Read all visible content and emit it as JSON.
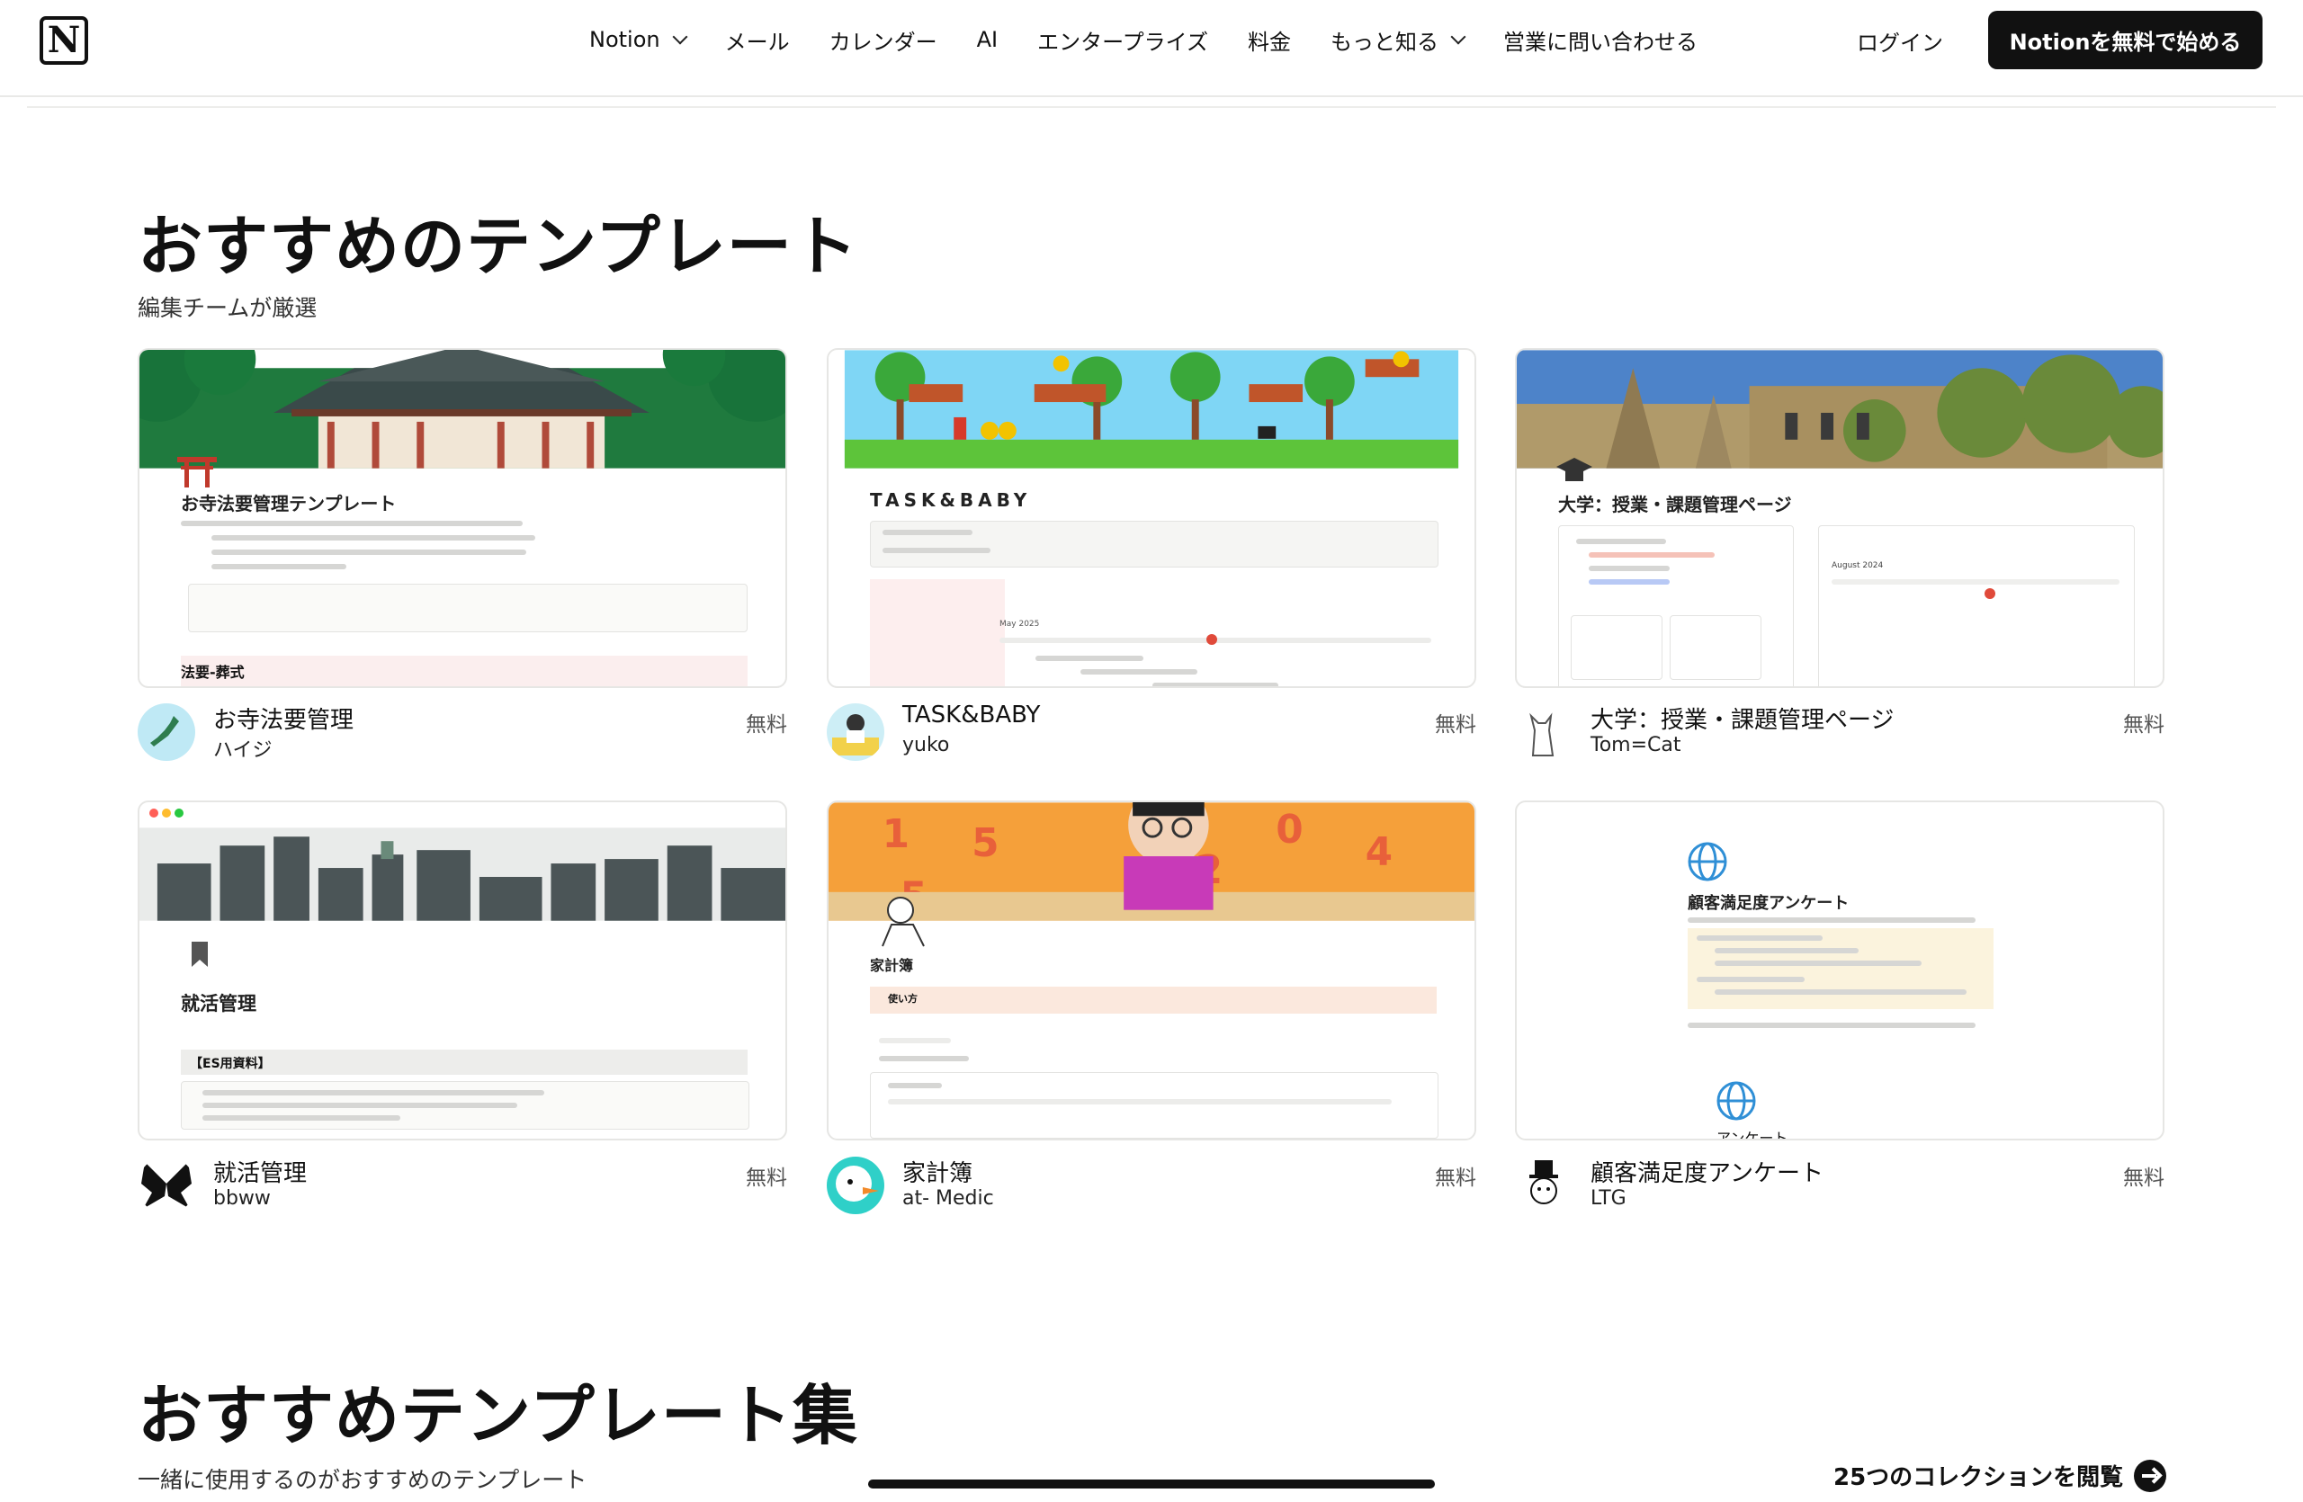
{
  "nav": {
    "logo": "N",
    "items": [
      {
        "label": "Notion",
        "dropdown": true
      },
      {
        "label": "メール",
        "dropdown": false
      },
      {
        "label": "カレンダー",
        "dropdown": false
      },
      {
        "label": "AI",
        "dropdown": false
      },
      {
        "label": "エンタープライズ",
        "dropdown": false
      },
      {
        "label": "料金",
        "dropdown": false
      },
      {
        "label": "もっと知る",
        "dropdown": true
      },
      {
        "label": "営業に問い合わせる",
        "dropdown": false
      }
    ],
    "login": "ログイン",
    "cta": "Notionを無料で始める"
  },
  "featured": {
    "title": "おすすめのテンプレート",
    "subtitle": "編集チームが厳選",
    "templates": [
      {
        "name": "お寺法要管理",
        "author": "ハイジ",
        "price": "無料",
        "preview_title": "お寺法要管理テンプレート",
        "preview_section": "法要-葬式"
      },
      {
        "name": "TASK&BABY",
        "author": "yuko",
        "price": "無料",
        "preview_title": "TASK&BABY",
        "preview_section": "May 2025"
      },
      {
        "name": "大学：授業・課題管理ページ",
        "author": "Tom=Cat",
        "price": "無料",
        "preview_title": "大学：授業・課題管理ページ",
        "preview_section": "August 2024"
      },
      {
        "name": "就活管理",
        "author": "bbww",
        "price": "無料",
        "preview_title": "就活管理",
        "preview_section": "【ES用資料】"
      },
      {
        "name": "家計簿",
        "author": "at- Medic",
        "price": "無料",
        "preview_title": "家計簿",
        "preview_section": "使い方"
      },
      {
        "name": "顧客満足度アンケート",
        "author": "LTG",
        "price": "無料",
        "preview_title": "顧客満足度アンケート",
        "preview_section": "アンケート"
      }
    ]
  },
  "collections": {
    "title": "おすすめテンプレート集",
    "subtitle": "一緒に使用するのがおすすめのテンプレート",
    "browse": "25つのコレクションを閲覧"
  },
  "colors": {
    "accent": "#111111",
    "border": "#e6e6e4",
    "muted": "#555555"
  }
}
